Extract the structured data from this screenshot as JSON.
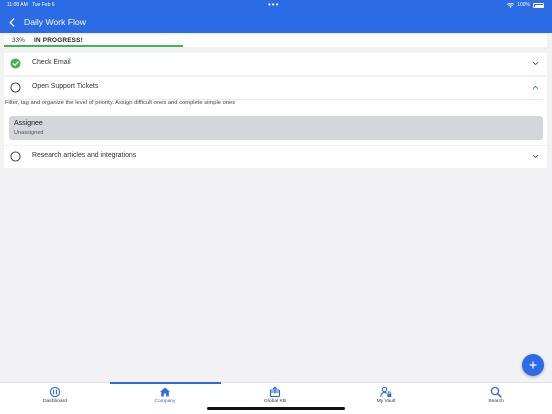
{
  "status_bar": {
    "time": "11:08 AM",
    "date": "Tue Feb 6",
    "battery": "100%"
  },
  "header": {
    "title": "Daily Work Flow"
  },
  "progress": {
    "percent_text": "33%",
    "status": "IN PROGRESS!",
    "fraction": 0.33,
    "color": "#4cb050"
  },
  "tasks": [
    {
      "label": "Check Email",
      "done": true
    },
    {
      "label": "Open Support Tickets",
      "done": false,
      "expanded": true,
      "description": "Filter, tag and organize the level of priority. Assign difficult ones and complete simple ones",
      "assignee": {
        "label": "Assignee",
        "value": "Unassigned"
      }
    },
    {
      "label": "Research articles and integrations",
      "done": false
    }
  ],
  "fab": {
    "icon": "plus-icon"
  },
  "tabs": [
    {
      "label": "Dashboard",
      "icon": "dashboard-icon"
    },
    {
      "label": "Company",
      "icon": "home-icon",
      "active": true
    },
    {
      "label": "Global KB",
      "icon": "box-icon"
    },
    {
      "label": "My Vault",
      "icon": "user-lock-icon"
    },
    {
      "label": "Search",
      "icon": "search-icon"
    }
  ],
  "colors": {
    "accent": "#2c6be6",
    "success": "#4cb050",
    "background": "#f2f2f4"
  }
}
